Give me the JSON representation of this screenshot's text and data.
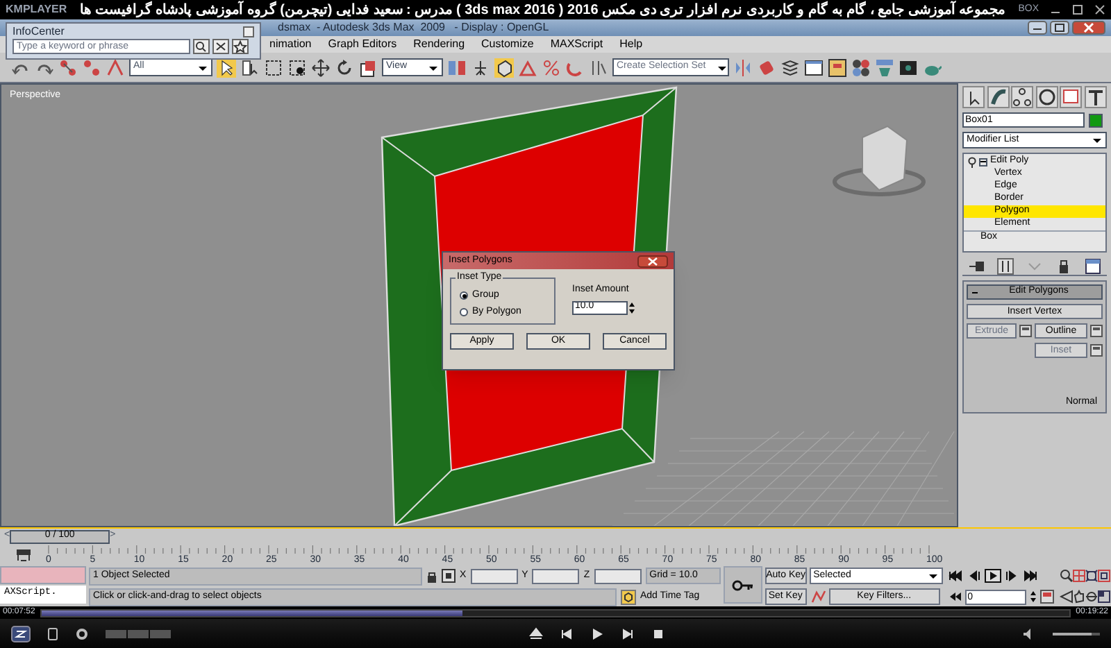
{
  "player": {
    "logo": "KMPLAYER",
    "title": "مجموعه آموزشی جامع ، گام به گام و کاربردی نرم افزار تری دی مکس 2016 ( 3ds max 2016 )  مدرس : سعید فدایی (تیچرمن) گروه آموزشی پادشاه گرافیست ها",
    "badge": "BOX",
    "time_elapsed": "00:07:52",
    "time_total": "00:19:22",
    "progress": {
      "level": 0.41
    },
    "volume": {
      "level": 0.82
    }
  },
  "app": {
    "title": "dsmax  - Autodesk 3ds Max  2009   - Display : OpenGL",
    "menus": [
      "nimation",
      "Graph Editors",
      "Rendering",
      "Customize",
      "MAXScript",
      "Help"
    ]
  },
  "infocenter": {
    "title": "InfoCenter",
    "search": {
      "placeholder": "Type a keyword or phrase"
    }
  },
  "toolbar": {
    "filter": "All",
    "ref_coord": "View",
    "selection_set": {
      "placeholder": "Create Selection Set"
    }
  },
  "viewport": {
    "label": "Perspective"
  },
  "command_panel": {
    "object_name": "Box01",
    "modifier_list": "Modifier List",
    "stack": [
      {
        "label": "Edit Poly",
        "expanded": true,
        "children": [
          {
            "label": "Vertex",
            "selected": false
          },
          {
            "label": "Edge",
            "selected": false
          },
          {
            "label": "Border",
            "selected": false
          },
          {
            "label": "Polygon",
            "selected": true
          },
          {
            "label": "Element",
            "selected": false
          }
        ]
      },
      {
        "label": "Box"
      }
    ],
    "rollout": {
      "title": "Edit Polygons",
      "insert": "Insert Vertex",
      "extrude": "Extrude",
      "outline": "Outline",
      "inset": "Inset"
    },
    "normal": "Normal"
  },
  "dialog": {
    "title": "Inset Polygons",
    "group": "Inset Type",
    "options": [
      {
        "label": "Group",
        "selected": true
      },
      {
        "label": "By Polygon",
        "selected": false
      }
    ],
    "amount_label": "Inset Amount",
    "amount": "10.0",
    "buttons": [
      "Apply",
      "OK",
      "Cancel"
    ]
  },
  "timeline": {
    "prev": "<",
    "next": ">",
    "frame": "0 / 100",
    "slider": {
      "level": 0
    },
    "ticks": [
      "0",
      "5",
      "10",
      "15",
      "20",
      "25",
      "30",
      "35",
      "40",
      "45",
      "50",
      "55",
      "60",
      "65",
      "70",
      "75",
      "80",
      "85",
      "90",
      "95",
      "100"
    ]
  },
  "status": {
    "listener": "AXScript.",
    "selected": "1 Object Selected",
    "prompt": "Click or click-and-drag to select objects",
    "x_label": "X",
    "y_label": "Y",
    "z_label": "Z",
    "grid": "Grid = 10.0",
    "add_time_tag": "Add Time Tag",
    "auto_key": "Auto Key",
    "key_mode": "Selected",
    "set_key": "Set Key",
    "key_filters": "Key Filters...",
    "current_frame": "0"
  }
}
